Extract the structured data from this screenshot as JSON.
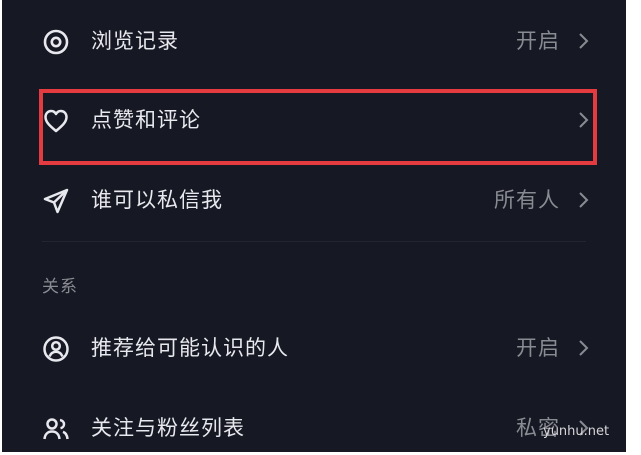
{
  "settings": {
    "items": [
      {
        "label": "浏览记录",
        "value": "开启",
        "icon": "eye-icon"
      },
      {
        "label": "点赞和评论",
        "value": "",
        "icon": "heart-icon"
      },
      {
        "label": "谁可以私信我",
        "value": "所有人",
        "icon": "send-icon"
      }
    ],
    "section_title": "关系",
    "relation_items": [
      {
        "label": "推荐给可能认识的人",
        "value": "开启",
        "icon": "user-circle-icon"
      },
      {
        "label": "关注与粉丝列表",
        "value": "私密",
        "icon": "users-icon"
      }
    ]
  },
  "highlight_color": "#e33b3f",
  "background_color": "#161823",
  "watermark": "yunhu.net"
}
